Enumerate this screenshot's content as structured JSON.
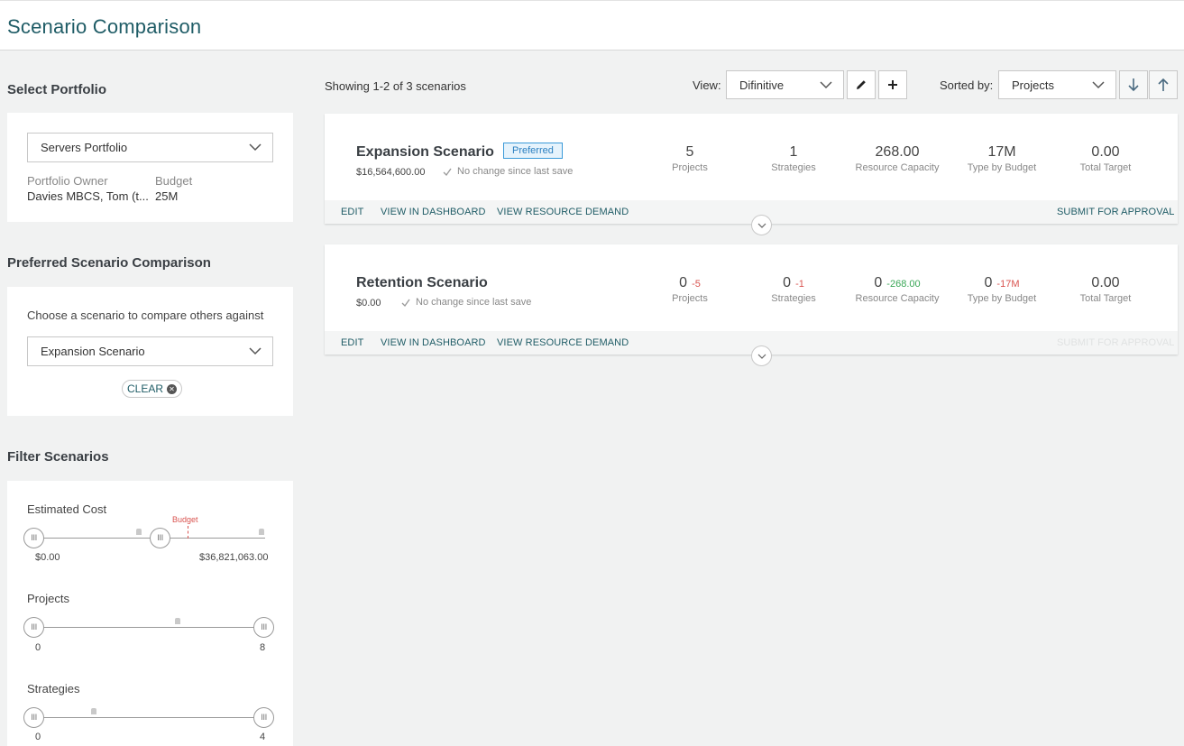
{
  "header": {
    "title": "Scenario Comparison"
  },
  "portfolio": {
    "section_title": "Select Portfolio",
    "selected": "Servers Portfolio",
    "owner_label": "Portfolio Owner",
    "owner_value": "Davies MBCS, Tom (t...",
    "budget_label": "Budget",
    "budget_value": "25M"
  },
  "preferred": {
    "section_title": "Preferred Scenario Comparison",
    "prompt": "Choose a scenario to compare others against",
    "selected": "Expansion Scenario",
    "clear_label": "CLEAR"
  },
  "filters": {
    "section_title": "Filter Scenarios",
    "estimated_cost": {
      "label": "Estimated Cost",
      "min_label": "$0.00",
      "max_label": "$36,821,063.00",
      "budget_marker": "Budget"
    },
    "projects": {
      "label": "Projects",
      "min_label": "0",
      "max_label": "8"
    },
    "strategies": {
      "label": "Strategies",
      "min_label": "0",
      "max_label": "4"
    }
  },
  "toolbar": {
    "showing": "Showing 1-2 of 3 scenarios",
    "view_label": "View:",
    "view_value": "Difinitive",
    "sorted_label": "Sorted by:",
    "sorted_value": "Projects"
  },
  "scenarios": [
    {
      "name": "Expansion Scenario",
      "badge": "Preferred",
      "cost": "$16,564,600.00",
      "save_status": "No change since last save",
      "metrics": [
        {
          "value": "5",
          "delta": "",
          "label": "Projects"
        },
        {
          "value": "1",
          "delta": "",
          "label": "Strategies"
        },
        {
          "value": "268.00",
          "delta": "",
          "label": "Resource Capacity"
        },
        {
          "value": "17M",
          "delta": "",
          "label": "Type by Budget"
        },
        {
          "value": "0.00",
          "delta": "",
          "label": "Total Target"
        }
      ],
      "actions": {
        "edit": "EDIT",
        "dashboard": "VIEW IN DASHBOARD",
        "demand": "VIEW RESOURCE DEMAND",
        "submit": "SUBMIT FOR APPROVAL"
      }
    },
    {
      "name": "Retention Scenario",
      "badge": "",
      "cost": "$0.00",
      "save_status": "No change since last save",
      "metrics": [
        {
          "value": "0",
          "delta": "-5",
          "label": "Projects"
        },
        {
          "value": "0",
          "delta": "-1",
          "label": "Strategies"
        },
        {
          "value": "0",
          "delta": "-268.00",
          "label": "Resource Capacity"
        },
        {
          "value": "0",
          "delta": "-17M",
          "label": "Type by Budget"
        },
        {
          "value": "0.00",
          "delta": "",
          "label": "Total Target"
        }
      ],
      "actions": {
        "edit": "EDIT",
        "dashboard": "VIEW IN DASHBOARD",
        "demand": "VIEW RESOURCE DEMAND",
        "submit": "SUBMIT FOR APPROVAL"
      }
    }
  ],
  "colors": {
    "accent": "#1f5c66",
    "negative": "#d9534f",
    "positive": "#3aa757",
    "badge": "#3a9ad9"
  }
}
